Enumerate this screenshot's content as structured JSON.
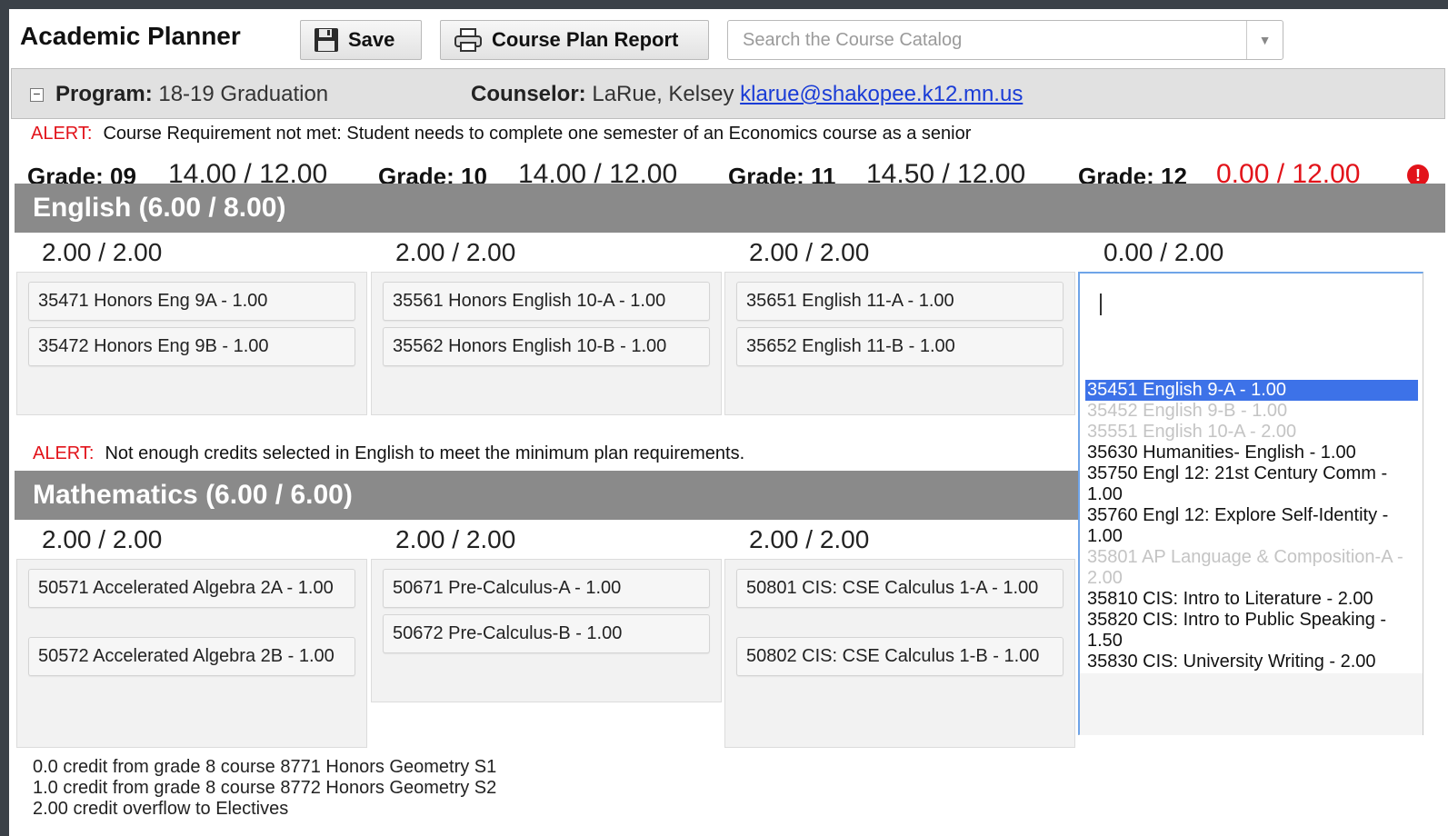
{
  "header": {
    "title": "Academic Planner",
    "save_label": "Save",
    "report_label": "Course Plan Report",
    "search_placeholder": "Search the Course Catalog"
  },
  "program": {
    "program_label": "Program:",
    "program_value": "18-19 Graduation",
    "counselor_label": "Counselor:",
    "counselor_value": "LaRue, Kelsey",
    "counselor_email": "klarue@shakopee.k12.mn.us"
  },
  "alerts": {
    "word": "ALERT:",
    "requirement": "Course Requirement not met: Student needs to complete one semester of an Economics course as a senior",
    "english_credits": "Not enough credits selected in English to meet the minimum plan requirements."
  },
  "grades": [
    {
      "label": "Grade: 09",
      "value": "14.00 / 12.00"
    },
    {
      "label": "Grade: 10",
      "value": "14.00 / 12.00"
    },
    {
      "label": "Grade: 11",
      "value": "14.50 / 12.00"
    },
    {
      "label": "Grade: 12",
      "value": "0.00 / 12.00"
    }
  ],
  "alert_icon": "!",
  "english": {
    "title": "English (6.00 / 8.00)",
    "col_sums": [
      "2.00 / 2.00",
      "2.00 / 2.00",
      "2.00 / 2.00",
      "0.00 / 2.00"
    ],
    "courses": [
      [
        "35471 Honors Eng 9A - 1.00",
        "35472 Honors Eng 9B - 1.00"
      ],
      [
        "35561 Honors English 10-A - 1.00",
        "35562 Honors English 10-B - 1.00"
      ],
      [
        "35651 English 11-A - 1.00",
        "35652 English 11-B - 1.00"
      ]
    ]
  },
  "math": {
    "title": "Mathematics (6.00 / 6.00)",
    "col_sums": [
      "2.00 / 2.00",
      "2.00 / 2.00",
      "2.00 / 2.00"
    ],
    "courses": [
      [
        "50571 Accelerated Algebra 2A - 1.00",
        "50572 Accelerated Algebra 2B - 1.00"
      ],
      [
        "50671 Pre-Calculus-A - 1.00",
        "50672 Pre-Calculus-B - 1.00"
      ],
      [
        "50801 CIS: CSE Calculus 1-A - 1.00",
        "50802 CIS: CSE Calculus 1-B - 1.00"
      ]
    ],
    "notes": [
      "0.0 credit from grade 8 course 8771 Honors Geometry S1",
      "1.0 credit from grade 8 course 8772 Honors Geometry S2",
      "2.00 credit overflow to Electives"
    ]
  },
  "picker_options": [
    {
      "text": "35451 English 9-A - 1.00",
      "state": "selected"
    },
    {
      "text": "35452 English 9-B - 1.00",
      "state": "disabled"
    },
    {
      "text": "35551 English 10-A - 2.00",
      "state": "disabled"
    },
    {
      "text": "35630 Humanities- English - 1.00",
      "state": "normal"
    },
    {
      "text": "35750 Engl 12: 21st Century Comm - 1.00",
      "state": "normal"
    },
    {
      "text": "35760 Engl 12: Explore Self-Identity - 1.00",
      "state": "normal"
    },
    {
      "text": "35801 AP Language & Composition-A - 2.00",
      "state": "disabled"
    },
    {
      "text": "35810 CIS: Intro to Literature - 2.00",
      "state": "normal"
    },
    {
      "text": "35820 CIS: Intro to Public Speaking - 1.50",
      "state": "normal"
    },
    {
      "text": "35830 CIS: University Writing - 2.00",
      "state": "normal"
    }
  ],
  "colors": {
    "alert_red": "#e2131a",
    "section_gray": "#8a8a8a",
    "selected_blue": "#3d72e8",
    "link_blue": "#1a3cd6"
  }
}
